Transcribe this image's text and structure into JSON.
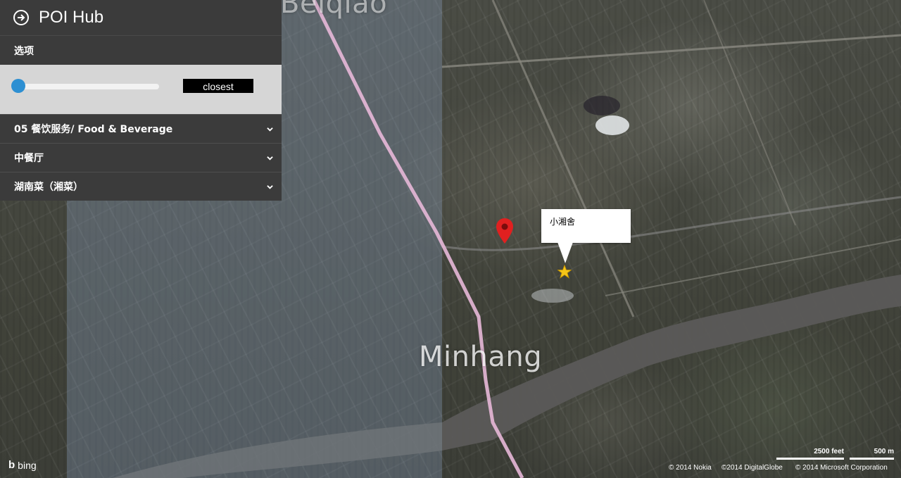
{
  "app": {
    "title": "POI Hub"
  },
  "panel": {
    "options_label": "选项",
    "slider": {
      "value_fraction": 0.0
    },
    "sort_button_label": "closest",
    "filters": [
      {
        "label": "05 餐饮服务/ Food & Beverage"
      },
      {
        "label": "中餐厅"
      },
      {
        "label": "湖南菜（湘菜）"
      }
    ]
  },
  "map": {
    "place_labels": {
      "minhang": "Minhang",
      "beiqiao": "Beiqiao"
    },
    "poi_callout": "小湘舍",
    "attribution": {
      "bing": "bing",
      "scale_feet": "2500 feet",
      "scale_m": "500 m",
      "nokia": "© 2014 Nokia",
      "digitalglobe": "©2014 DigitalGlobe",
      "microsoft": "© 2014 Microsoft Corporation"
    }
  },
  "colors": {
    "panel_bg": "#3b3b3b",
    "controls_bg": "#d6d6d6",
    "slider_thumb": "#2d8fd2",
    "pin": "#e02020",
    "star": "#f5c518",
    "rail_line": "#e7b8d8"
  },
  "icons": {
    "header": "arrow-right-circle-icon",
    "dropdown": "chevron-down-icon",
    "location": "map-pin-icon",
    "poi": "star-icon"
  }
}
